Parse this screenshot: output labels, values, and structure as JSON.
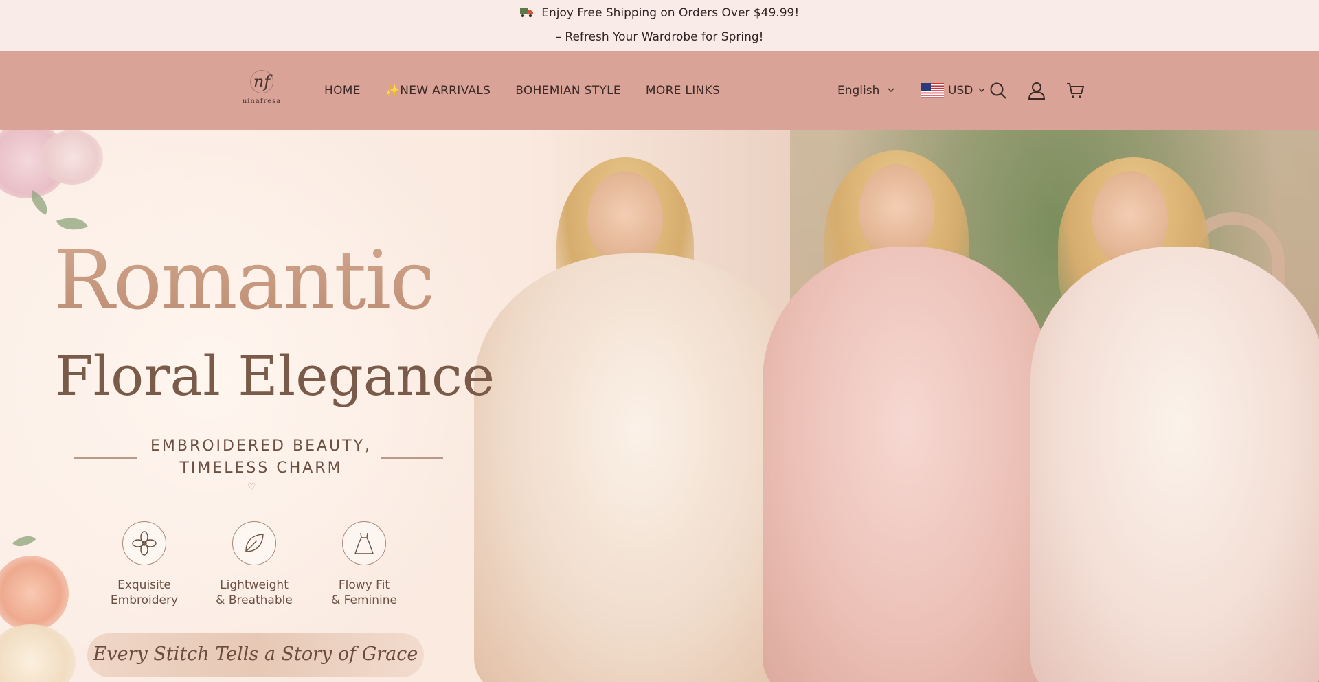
{
  "announcement": {
    "line1": "Enjoy Free Shipping on Orders Over $49.99!",
    "line2": "– Refresh Your Wardrobe for Spring!"
  },
  "header": {
    "logo_monogram": "nf",
    "logo_word": "ninafresa",
    "nav": [
      {
        "label": "HOME"
      },
      {
        "label": "NEW ARRIVALS",
        "prefix": "✨"
      },
      {
        "label": "BOHEMIAN STYLE"
      },
      {
        "label": "MORE LINKS"
      }
    ],
    "language": "English",
    "currency": "USD",
    "icons": [
      "search-icon",
      "account-icon",
      "cart-icon"
    ]
  },
  "hero": {
    "title_line1": "Romantic",
    "title_line2": "Floral Elegance",
    "subtitle_line1": "EMBROIDERED BEAUTY,",
    "subtitle_line2": "TIMELESS CHARM",
    "features": [
      {
        "icon": "flower-icon",
        "line1": "Exquisite",
        "line2": "Embroidery"
      },
      {
        "icon": "leaf-icon",
        "line1": "Lightweight",
        "line2": "& Breathable"
      },
      {
        "icon": "dress-icon",
        "line1": "Flowy Fit",
        "line2": "& Feminine"
      }
    ],
    "tagline": "Every Stitch Tells a Story of Grace"
  },
  "colors": {
    "announcement_bg": "#f9ebe8",
    "header_bg": "#d9a398",
    "text": "#3a2824"
  }
}
